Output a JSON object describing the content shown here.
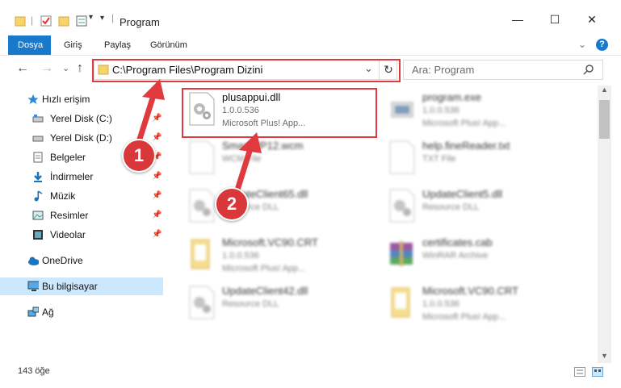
{
  "window": {
    "title": "Program",
    "minimize": "—",
    "maximize": "☐",
    "close": "✕"
  },
  "ribbon": {
    "tabs": [
      {
        "label": "Dosya",
        "active": true
      },
      {
        "label": "Giriş"
      },
      {
        "label": "Paylaş"
      },
      {
        "label": "Görünüm"
      }
    ],
    "help": "?",
    "collapse": "⌄"
  },
  "nav": {
    "back": "←",
    "forward": "→",
    "recent": "⌄",
    "up": "↑",
    "address": "C:\\Program Files\\Program Dizini",
    "refresh": "↻",
    "search_placeholder": "Ara: Program"
  },
  "sidebar": {
    "items": [
      {
        "label": "Hızlı erişim",
        "icon": "star-icon",
        "top": true
      },
      {
        "label": "Yerel Disk (C:)",
        "icon": "drive-icon",
        "pinned": true
      },
      {
        "label": "Yerel Disk (D:)",
        "icon": "drive-icon",
        "pinned": true
      },
      {
        "label": "Belgeler",
        "icon": "document-icon",
        "pinned": true
      },
      {
        "label": "İndirmeler",
        "icon": "download-icon",
        "pinned": true
      },
      {
        "label": "Müzik",
        "icon": "music-icon",
        "pinned": true
      },
      {
        "label": "Resimler",
        "icon": "pictures-icon",
        "pinned": true
      },
      {
        "label": "Videolar",
        "icon": "video-icon",
        "pinned": true
      },
      {
        "label": "OneDrive",
        "icon": "cloud-icon",
        "top": true
      },
      {
        "label": "Bu bilgisayar",
        "icon": "computer-icon",
        "top": true,
        "selected": true
      },
      {
        "label": "Ağ",
        "icon": "network-icon",
        "top": true
      }
    ]
  },
  "files": [
    {
      "name": "plusappui.dll",
      "meta1": "1.0.0.536",
      "meta2": "Microsoft Plus! App...",
      "icon": "dll-gear-icon"
    },
    {
      "name": "program.exe",
      "meta1": "1.0.0.536",
      "meta2": "Microsoft Plus! App...",
      "icon": "exe-icon"
    },
    {
      "name": "SmartWP12.wcm",
      "meta1": "WCM File",
      "meta2": "",
      "icon": "blank-file-icon"
    },
    {
      "name": "help.fineReader.txt",
      "meta1": "TXT File",
      "meta2": "",
      "icon": "blank-file-icon"
    },
    {
      "name": "UpdateClient65.dll",
      "meta1": "Resource DLL",
      "meta2": "",
      "icon": "dll-gear-icon"
    },
    {
      "name": "UpdateClient5.dll",
      "meta1": "Resource DLL",
      "meta2": "",
      "icon": "dll-gear-icon"
    },
    {
      "name": "Microsoft.VC90.CRT",
      "meta1": "1.0.0.536",
      "meta2": "Microsoft Plus! App...",
      "icon": "folder-doc-icon"
    },
    {
      "name": "certificates.cab",
      "meta1": "WinRAR Archive",
      "meta2": "",
      "icon": "winrar-icon"
    },
    {
      "name": "UpdateClient42.dll",
      "meta1": "Resource DLL",
      "meta2": "",
      "icon": "dll-gear-icon"
    },
    {
      "name": "Microsoft.VC90.CRT",
      "meta1": "1.0.0.536",
      "meta2": "Microsoft Plus! App...",
      "icon": "folder-doc-icon"
    }
  ],
  "status": {
    "count": "143 öğe"
  },
  "annotations": {
    "step1": "1",
    "step2": "2"
  },
  "colors": {
    "accent": "#1979ca",
    "annotation": "#e03a3e",
    "selected": "#cce8ff"
  }
}
